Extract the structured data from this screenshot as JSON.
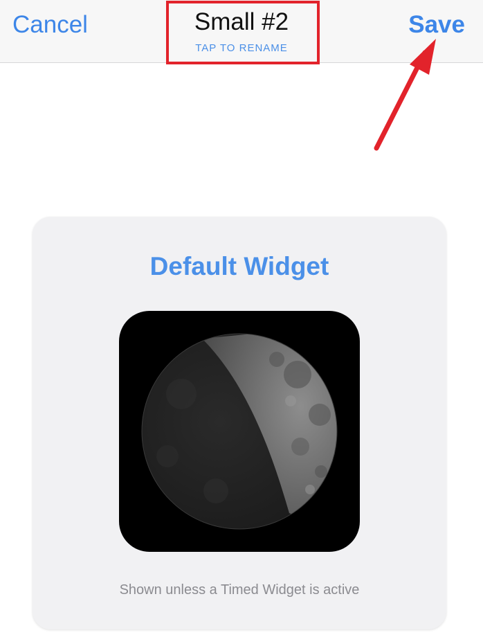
{
  "nav": {
    "cancel_label": "Cancel",
    "title": "Small #2",
    "subtitle": "TAP TO RENAME",
    "save_label": "Save"
  },
  "card": {
    "title": "Default Widget",
    "caption": "Shown unless a Timed Widget is active",
    "preview_icon": "moon-phase-waxing-crescent"
  },
  "colors": {
    "accent": "#3d86e8",
    "annotation": "#e2232b",
    "card_background": "#f1f1f3"
  }
}
